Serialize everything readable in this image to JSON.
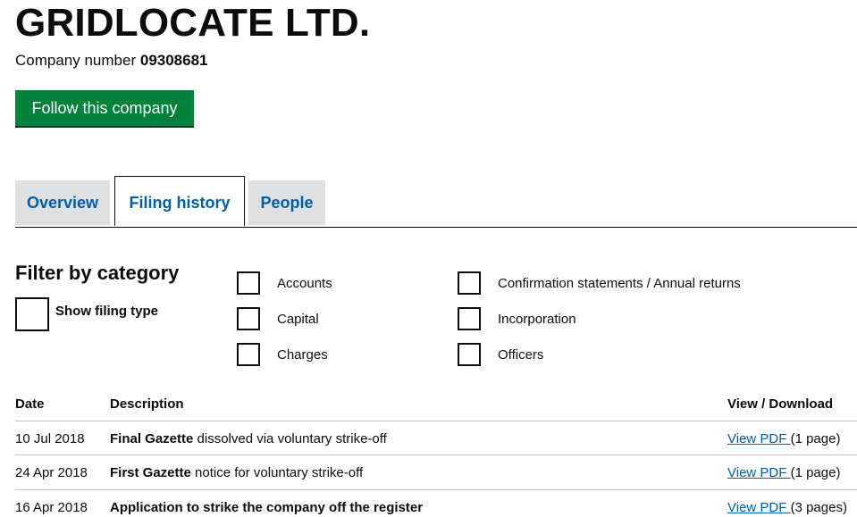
{
  "company": {
    "name": "GRIDLOCATE LTD.",
    "number_label": "Company number",
    "number": "09308681",
    "follow_label": "Follow this company"
  },
  "tabs": [
    {
      "label": "Overview",
      "active": false
    },
    {
      "label": "Filing history",
      "active": true
    },
    {
      "label": "People",
      "active": false
    }
  ],
  "filter": {
    "heading": "Filter by category",
    "show_filing_type": "Show filing type",
    "categories": [
      "Accounts",
      "Capital",
      "Charges",
      "Confirmation statements / Annual returns",
      "Incorporation",
      "Officers"
    ]
  },
  "table": {
    "headers": {
      "date": "Date",
      "description": "Description",
      "view": "View / Download"
    },
    "rows": [
      {
        "date": "10 Jul 2018",
        "desc_bold": "Final Gazette",
        "desc_rest": " dissolved via voluntary strike-off",
        "link": "View PDF ",
        "pages": "(1 page)"
      },
      {
        "date": "24 Apr 2018",
        "desc_bold": "First Gazette",
        "desc_rest": " notice for voluntary strike-off",
        "link": "View PDF ",
        "pages": "(1 page)"
      },
      {
        "date": "16 Apr 2018",
        "desc_bold": "Application to strike the company off the register",
        "desc_rest": "",
        "link": "View PDF ",
        "pages": "(3 pages)"
      }
    ]
  }
}
